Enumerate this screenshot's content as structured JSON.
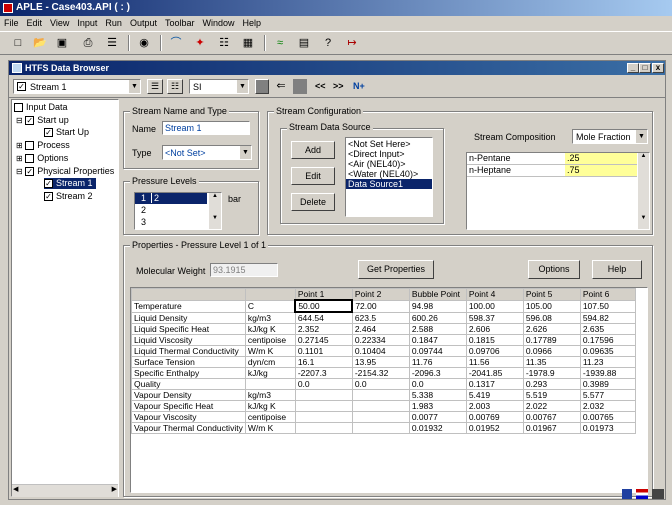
{
  "app_title": "APLE - Case403.API ( : )",
  "menu": [
    "File",
    "Edit",
    "View",
    "Input",
    "Run",
    "Output",
    "Toolbar",
    "Window",
    "Help"
  ],
  "browser_title": "HTFS Data Browser",
  "stream_select": "Stream 1",
  "units_select": "SI",
  "nav": {
    "prev": "<<",
    "next": ">>",
    "new": "N+"
  },
  "tree": {
    "input_data": "Input Data",
    "startup": "Start up",
    "startup_child": "Start Up",
    "process": "Process",
    "options": "Options",
    "physical_properties": "Physical Properties",
    "stream1": "Stream 1",
    "stream2": "Stream 2"
  },
  "stream_name_type": {
    "label": "Stream Name and Type",
    "name_label": "Name",
    "name_value": "Stream 1",
    "type_label": "Type",
    "type_value": "<Not Set>"
  },
  "pressure_levels": {
    "label": "Pressure Levels",
    "unit": "bar",
    "rows": [
      {
        "n": "1",
        "v": "2"
      },
      {
        "n": "2",
        "v": ""
      },
      {
        "n": "3",
        "v": ""
      }
    ]
  },
  "stream_config": {
    "label": "Stream Configuration",
    "source_label": "Stream Data Source",
    "add": "Add",
    "edit": "Edit",
    "delete": "Delete",
    "sources": [
      "<Not Set Here>",
      "<Direct Input>",
      "<Air (NEL40)>",
      "<Water (NEL40)>",
      "Data Source1"
    ],
    "composition_label": "Stream Composition",
    "composition_type": "Mole Fraction",
    "components": [
      {
        "name": "n-Pentane",
        "value": ".25"
      },
      {
        "name": "n-Heptane",
        "value": ".75"
      }
    ]
  },
  "properties": {
    "label": "Properties - Pressure Level 1 of 1",
    "mw_label": "Molecular Weight",
    "mw_value": "93.1915",
    "get_properties": "Get Properties",
    "options": "Options",
    "help": "Help",
    "headers": [
      "",
      "",
      "Point 1",
      "Point 2",
      "Bubble Point",
      "Point 4",
      "Point 5",
      "Point 6"
    ],
    "rows": [
      [
        "Temperature",
        "C",
        "50.00",
        "72.00",
        "94.98",
        "100.00",
        "105.00",
        "107.50"
      ],
      [
        "Liquid Density",
        "kg/m3",
        "644.54",
        "623.5",
        "600.26",
        "598.37",
        "596.08",
        "594.82"
      ],
      [
        "Liquid Specific Heat",
        "kJ/kg K",
        "2.352",
        "2.464",
        "2.588",
        "2.606",
        "2.626",
        "2.635"
      ],
      [
        "Liquid Viscosity",
        "centipoise",
        "0.27145",
        "0.22334",
        "0.1847",
        "0.1815",
        "0.17789",
        "0.17596"
      ],
      [
        "Liquid Thermal Conductivity",
        "W/m K",
        "0.1101",
        "0.10404",
        "0.09744",
        "0.09706",
        "0.0966",
        "0.09635"
      ],
      [
        "Surface Tension",
        "dyn/cm",
        "16.1",
        "13.95",
        "11.76",
        "11.56",
        "11.35",
        "11.23"
      ],
      [
        "Specific Enthalpy",
        "kJ/kg",
        "-2207.3",
        "-2154.32",
        "-2096.3",
        "-2041.85",
        "-1978.9",
        "-1939.88"
      ],
      [
        "Quality",
        "",
        "0.0",
        "0.0",
        "0.0",
        "0.1317",
        "0.293",
        "0.3989"
      ],
      [
        "Vapour Density",
        "kg/m3",
        "",
        "",
        "5.338",
        "5.419",
        "5.519",
        "5.577"
      ],
      [
        "Vapour Specific Heat",
        "kJ/kg K",
        "",
        "",
        "1.983",
        "2.003",
        "2.022",
        "2.032"
      ],
      [
        "Vapour Viscosity",
        "centipoise",
        "",
        "",
        "0.0077",
        "0.00769",
        "0.00767",
        "0.00765"
      ],
      [
        "Vapour Thermal Conductivity",
        "W/m K",
        "",
        "",
        "0.01932",
        "0.01952",
        "0.01967",
        "0.01973"
      ]
    ]
  },
  "colors": {
    "title_dark": "#0a246a",
    "title_light": "#a6caf0",
    "select": "#0a246a",
    "composition_value": "#ffff99",
    "highlight": "#ffffc0"
  }
}
